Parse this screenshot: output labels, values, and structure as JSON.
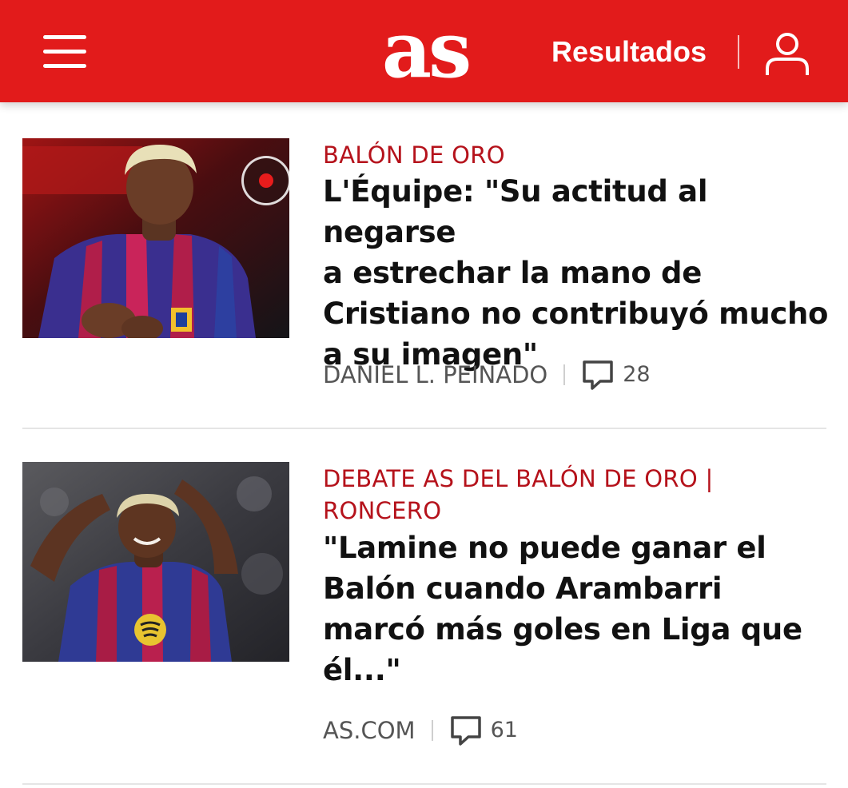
{
  "header": {
    "menu_icon": "hamburger-menu-icon",
    "logo_text": "as",
    "results_label": "Resultados",
    "user_icon": "user-account-icon",
    "background_color": "#e21b1b"
  },
  "articles": [
    {
      "kicker": "BALÓN DE ORO",
      "headline_lines": [
        "L'Équipe: \"Su actitud al negarse",
        "a estrechar la mano de",
        "Cristiano no contribuyó mucho",
        "a su imagen\""
      ],
      "author": "DANIEL L. PEINADO",
      "comment_icon": "comment-bubble-icon",
      "comments": "28",
      "media_badge_icon": "live-record-icon"
    },
    {
      "kicker_lines": [
        "DEBATE AS DEL BALÓN DE ORO |",
        "RONCERO"
      ],
      "headline_lines": [
        "\"Lamine no puede ganar el",
        "Balón cuando Arambarri",
        "marcó más goles en Liga que",
        "él...\""
      ],
      "author": "AS.COM",
      "comment_icon": "comment-bubble-icon",
      "comments": "61"
    }
  ],
  "colors": {
    "accent": "#e21b1b",
    "kicker": "#b5121b",
    "meta": "#555555"
  }
}
